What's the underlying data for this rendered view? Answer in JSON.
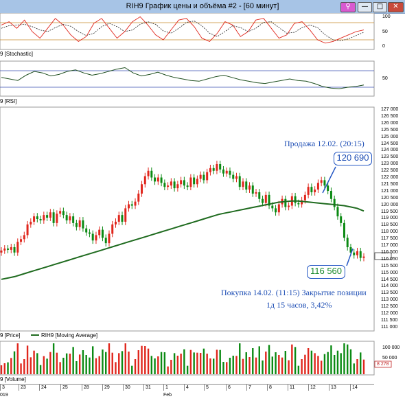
{
  "window": {
    "title": "RIH9 График цены и объёма #2 - [60 минут]",
    "buttons": {
      "extra": "⚲",
      "minimize": "—",
      "maximize": "□",
      "close": "✕"
    }
  },
  "panels": {
    "stochastic": {
      "label": "9 [Stochastic]",
      "axis": [
        "100",
        "50",
        "0"
      ]
    },
    "rsi": {
      "label": "9 [RSI]",
      "axis": [
        "50"
      ]
    },
    "price": {
      "legend_price": "9 [Price]",
      "legend_ma": "RIH9 [Moving Average]",
      "axis": [
        "127 000",
        "126 500",
        "126 000",
        "125 500",
        "125 000",
        "124 500",
        "124 000",
        "123 500",
        "123 000",
        "122 500",
        "122 000",
        "121 500",
        "121 000",
        "120 500",
        "120 000",
        "119 500",
        "119 000",
        "118 500",
        "118 000",
        "117 500",
        "117 000",
        "116 500",
        "116 050",
        "115 500",
        "115 000",
        "114 500",
        "114 000",
        "113 500",
        "113 000",
        "112 500",
        "112 000",
        "111 500",
        "111 000"
      ],
      "last_value": "116 050"
    },
    "volume": {
      "label": "9 [Volume]",
      "axis": [
        "100 000",
        "50 000"
      ],
      "last_value": "8 278"
    }
  },
  "annotations": {
    "sell_text": "Продажа 12.02. (20:15)",
    "sell_price": "120 690",
    "buy_price": "116 560",
    "buy_text": "Покупка 14.02. (11:15)  Закрытие позиции",
    "result_text": "1д 15 часов, 3,42%"
  },
  "dates": {
    "row1": [
      "3",
      "23",
      "24",
      "25",
      "28",
      "29",
      "30",
      "31",
      "1",
      "4",
      "5",
      "6",
      "7",
      "8",
      "11",
      "12",
      "13",
      "14"
    ],
    "row2": [
      "019",
      "Feb"
    ]
  },
  "colors": {
    "up": "#e0261c",
    "down": "#0b8a13",
    "ma": "#1f6b1f",
    "accent": "#1f4fb5",
    "stoch_k": "#e0261c",
    "stoch_d": "#222222",
    "rsi": "#1f4f1f",
    "level": "#c98a2a"
  },
  "chart_data": {
    "type": "candlestick",
    "y_range": [
      110800,
      127200
    ],
    "price_close": [
      116650,
      116800,
      116700,
      116900,
      116500,
      117300,
      117500,
      117800,
      118600,
      118800,
      119200,
      119000,
      118900,
      119300,
      119100,
      119500,
      118700,
      119400,
      119600,
      119300,
      118900,
      119200,
      118700,
      118400,
      118900,
      118300,
      118000,
      117900,
      117400,
      117800,
      118200,
      117600,
      117200,
      117900,
      118600,
      118800,
      119300,
      118800,
      119800,
      120100,
      120000,
      120300,
      120900,
      121600,
      122200,
      122600,
      122100,
      121800,
      122100,
      121700,
      121400,
      121500,
      121800,
      121300,
      121600,
      121900,
      121500,
      121400,
      122100,
      121600,
      122000,
      122300,
      121900,
      122500,
      122800,
      122600,
      123100,
      122700,
      122400,
      122600,
      122300,
      122000,
      122200,
      121400,
      121800,
      121200,
      121500,
      120900,
      121000,
      120500,
      120200,
      120800,
      120000,
      119800,
      119500,
      120100,
      120500,
      119900,
      120000,
      120700,
      120200,
      120100,
      120400,
      120800,
      121400,
      121000,
      121200,
      121700,
      121900,
      121500,
      121100,
      120500,
      119900,
      119200,
      118700,
      117600,
      116900,
      116500,
      116300,
      116600,
      116100,
      116200
    ],
    "price_open": [
      116500,
      116650,
      116800,
      116700,
      116900,
      116500,
      117300,
      117500,
      117800,
      118600,
      118800,
      119200,
      119000,
      118900,
      119300,
      119100,
      119500,
      118700,
      119400,
      119600,
      119300,
      118900,
      119200,
      118700,
      118400,
      118900,
      118300,
      118000,
      117900,
      117400,
      117800,
      118200,
      117600,
      117200,
      117900,
      118600,
      118800,
      119300,
      118800,
      119800,
      120100,
      120000,
      120300,
      120900,
      121600,
      122200,
      122600,
      122100,
      121800,
      122100,
      121700,
      121400,
      121500,
      121800,
      121300,
      121600,
      121900,
      121500,
      121400,
      122100,
      121600,
      122000,
      122300,
      121900,
      122500,
      122800,
      122600,
      123100,
      122700,
      122400,
      122600,
      122300,
      122000,
      122200,
      121400,
      121800,
      121200,
      121500,
      120900,
      121000,
      120500,
      120200,
      120800,
      120000,
      119800,
      119500,
      120100,
      120500,
      119900,
      120000,
      120700,
      120200,
      120100,
      120400,
      120800,
      121400,
      121000,
      121200,
      121700,
      121900,
      121500,
      121100,
      120500,
      119900,
      119200,
      118700,
      117600,
      116900,
      116500,
      116300,
      116600,
      116100
    ],
    "moving_average": [
      114500,
      114600,
      114700,
      114850,
      115000,
      115150,
      115300,
      115450,
      115600,
      115750,
      115900,
      116050,
      116200,
      116350,
      116500,
      116650,
      116800,
      116950,
      117100,
      117250,
      117400,
      117550,
      117700,
      117850,
      118000,
      118150,
      118300,
      118450,
      118600,
      118750,
      118900,
      119050,
      119200,
      119350,
      119450,
      119550,
      119650,
      119750,
      119850,
      119950,
      120050,
      120150,
      120250,
      120300,
      120350,
      120350,
      120300,
      120250,
      120200,
      120150,
      120100,
      120050,
      120000,
      119900,
      119800,
      119600
    ],
    "stochastic_k": [
      70,
      80,
      60,
      85,
      50,
      30,
      60,
      90,
      70,
      40,
      20,
      35,
      75,
      90,
      60,
      30,
      50,
      80,
      95,
      70,
      40,
      25,
      55,
      85,
      90,
      65,
      30,
      20,
      45,
      80,
      70,
      35,
      50,
      85,
      90,
      60,
      30,
      40,
      75,
      80,
      55,
      25,
      15,
      20,
      30,
      40,
      50,
      55
    ],
    "stochastic_d": [
      60,
      68,
      70,
      72,
      65,
      55,
      50,
      62,
      72,
      66,
      50,
      38,
      45,
      65,
      75,
      65,
      50,
      55,
      72,
      80,
      72,
      52,
      45,
      60,
      78,
      82,
      68,
      45,
      35,
      50,
      68,
      62,
      50,
      60,
      78,
      80,
      62,
      45,
      48,
      62,
      70,
      62,
      40,
      25,
      22,
      28,
      38,
      48
    ],
    "rsi": [
      52,
      50,
      48,
      55,
      60,
      58,
      54,
      56,
      60,
      62,
      58,
      55,
      57,
      60,
      63,
      65,
      58,
      54,
      56,
      59,
      55,
      52,
      50,
      48,
      47,
      50,
      53,
      55,
      52,
      49,
      47,
      45,
      44,
      46,
      48,
      50,
      48,
      47,
      44,
      40,
      38,
      37,
      39,
      40,
      42
    ]
  }
}
